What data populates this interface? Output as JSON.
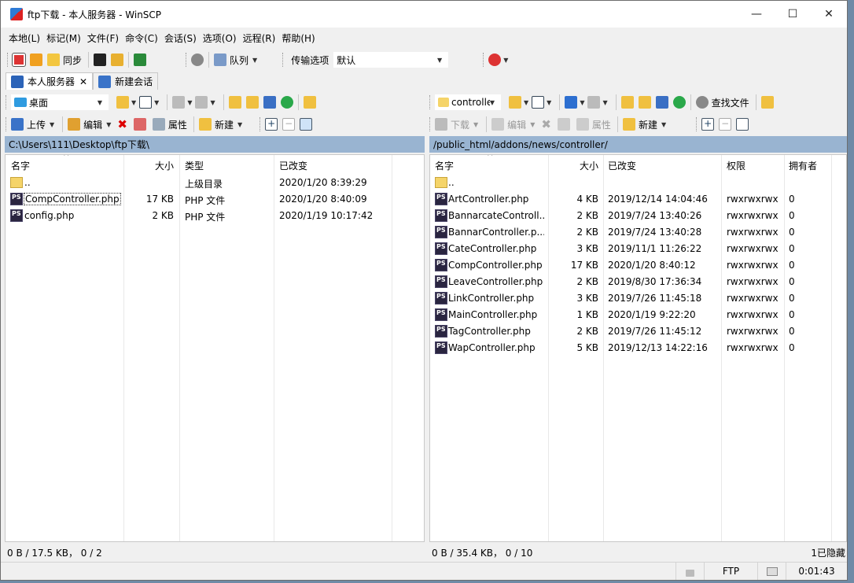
{
  "window": {
    "title": "ftp下载 - 本人服务器 - WinSCP",
    "controls": {
      "minimize": "—",
      "maximize": "☐",
      "close": "✕"
    }
  },
  "menu": [
    "本地(L)",
    "标记(M)",
    "文件(F)",
    "命令(C)",
    "会话(S)",
    "选项(O)",
    "远程(R)",
    "帮助(H)"
  ],
  "toolbar": {
    "sync_label": "同步",
    "queue_label": "队列",
    "transfer_label": "传输选项",
    "transfer_value": "默认"
  },
  "tabs": [
    {
      "label": "本人服务器",
      "close": "✕"
    },
    {
      "label": "新建会话"
    }
  ],
  "left": {
    "drive": "桌面",
    "actions": {
      "upload": "上传",
      "edit": "编辑",
      "properties": "属性",
      "new": "新建"
    },
    "path": "C:\\Users\\111\\Desktop\\ftp下载\\",
    "columns": {
      "name": "名字",
      "size": "大小",
      "type": "类型",
      "changed": "已改变"
    },
    "files": [
      {
        "name": "..",
        "size": "",
        "type": "上级目录",
        "changed": "2020/1/20  8:39:29",
        "icon": "parent-folder"
      },
      {
        "name": "CompController.php",
        "size": "17 KB",
        "type": "PHP 文件",
        "changed": "2020/1/20  8:40:09",
        "icon": "phpstorm-file"
      },
      {
        "name": "config.php",
        "size": "2 KB",
        "type": "PHP 文件",
        "changed": "2020/1/19  10:17:42",
        "icon": "phpstorm-file"
      }
    ],
    "status": "0 B / 17.5 KB，  0 / 2"
  },
  "right": {
    "dir": "controller",
    "actions": {
      "download": "下载",
      "edit": "编辑",
      "properties": "属性",
      "new": "新建",
      "find": "查找文件"
    },
    "path": "/public_html/addons/news/controller/",
    "columns": {
      "name": "名字",
      "size": "大小",
      "changed": "已改变",
      "rights": "权限",
      "owner": "拥有者"
    },
    "files": [
      {
        "name": "..",
        "size": "",
        "changed": "",
        "rights": "",
        "owner": "",
        "icon": "parent-folder"
      },
      {
        "name": "ArtController.php",
        "size": "4 KB",
        "changed": "2019/12/14 14:04:46",
        "rights": "rwxrwxrwx",
        "owner": "0",
        "icon": "phpstorm-file"
      },
      {
        "name": "BannarcateControll...",
        "size": "2 KB",
        "changed": "2019/7/24 13:40:26",
        "rights": "rwxrwxrwx",
        "owner": "0",
        "icon": "phpstorm-file"
      },
      {
        "name": "BannarController.p...",
        "size": "2 KB",
        "changed": "2019/7/24 13:40:28",
        "rights": "rwxrwxrwx",
        "owner": "0",
        "icon": "phpstorm-file"
      },
      {
        "name": "CateController.php",
        "size": "3 KB",
        "changed": "2019/11/1 11:26:22",
        "rights": "rwxrwxrwx",
        "owner": "0",
        "icon": "phpstorm-file"
      },
      {
        "name": "CompController.php",
        "size": "17 KB",
        "changed": "2020/1/20 8:40:12",
        "rights": "rwxrwxrwx",
        "owner": "0",
        "icon": "phpstorm-file"
      },
      {
        "name": "LeaveController.php",
        "size": "2 KB",
        "changed": "2019/8/30 17:36:34",
        "rights": "rwxrwxrwx",
        "owner": "0",
        "icon": "phpstorm-file"
      },
      {
        "name": "LinkController.php",
        "size": "3 KB",
        "changed": "2019/7/26 11:45:18",
        "rights": "rwxrwxrwx",
        "owner": "0",
        "icon": "phpstorm-file"
      },
      {
        "name": "MainController.php",
        "size": "1 KB",
        "changed": "2020/1/19 9:22:20",
        "rights": "rwxrwxrwx",
        "owner": "0",
        "icon": "phpstorm-file"
      },
      {
        "name": "TagController.php",
        "size": "2 KB",
        "changed": "2019/7/26 11:45:12",
        "rights": "rwxrwxrwx",
        "owner": "0",
        "icon": "phpstorm-file"
      },
      {
        "name": "WapController.php",
        "size": "5 KB",
        "changed": "2019/12/13 14:22:16",
        "rights": "rwxrwxrwx",
        "owner": "0",
        "icon": "phpstorm-file"
      }
    ],
    "status": "0 B / 35.4 KB，  0 / 10",
    "hidden": "1已隐藏"
  },
  "statusbar": {
    "protocol": "FTP",
    "time": "0:01:43"
  },
  "colors": {
    "path_bar": "#99b4d1",
    "php_icon": "#2a2540",
    "folder": "#f5d469"
  }
}
